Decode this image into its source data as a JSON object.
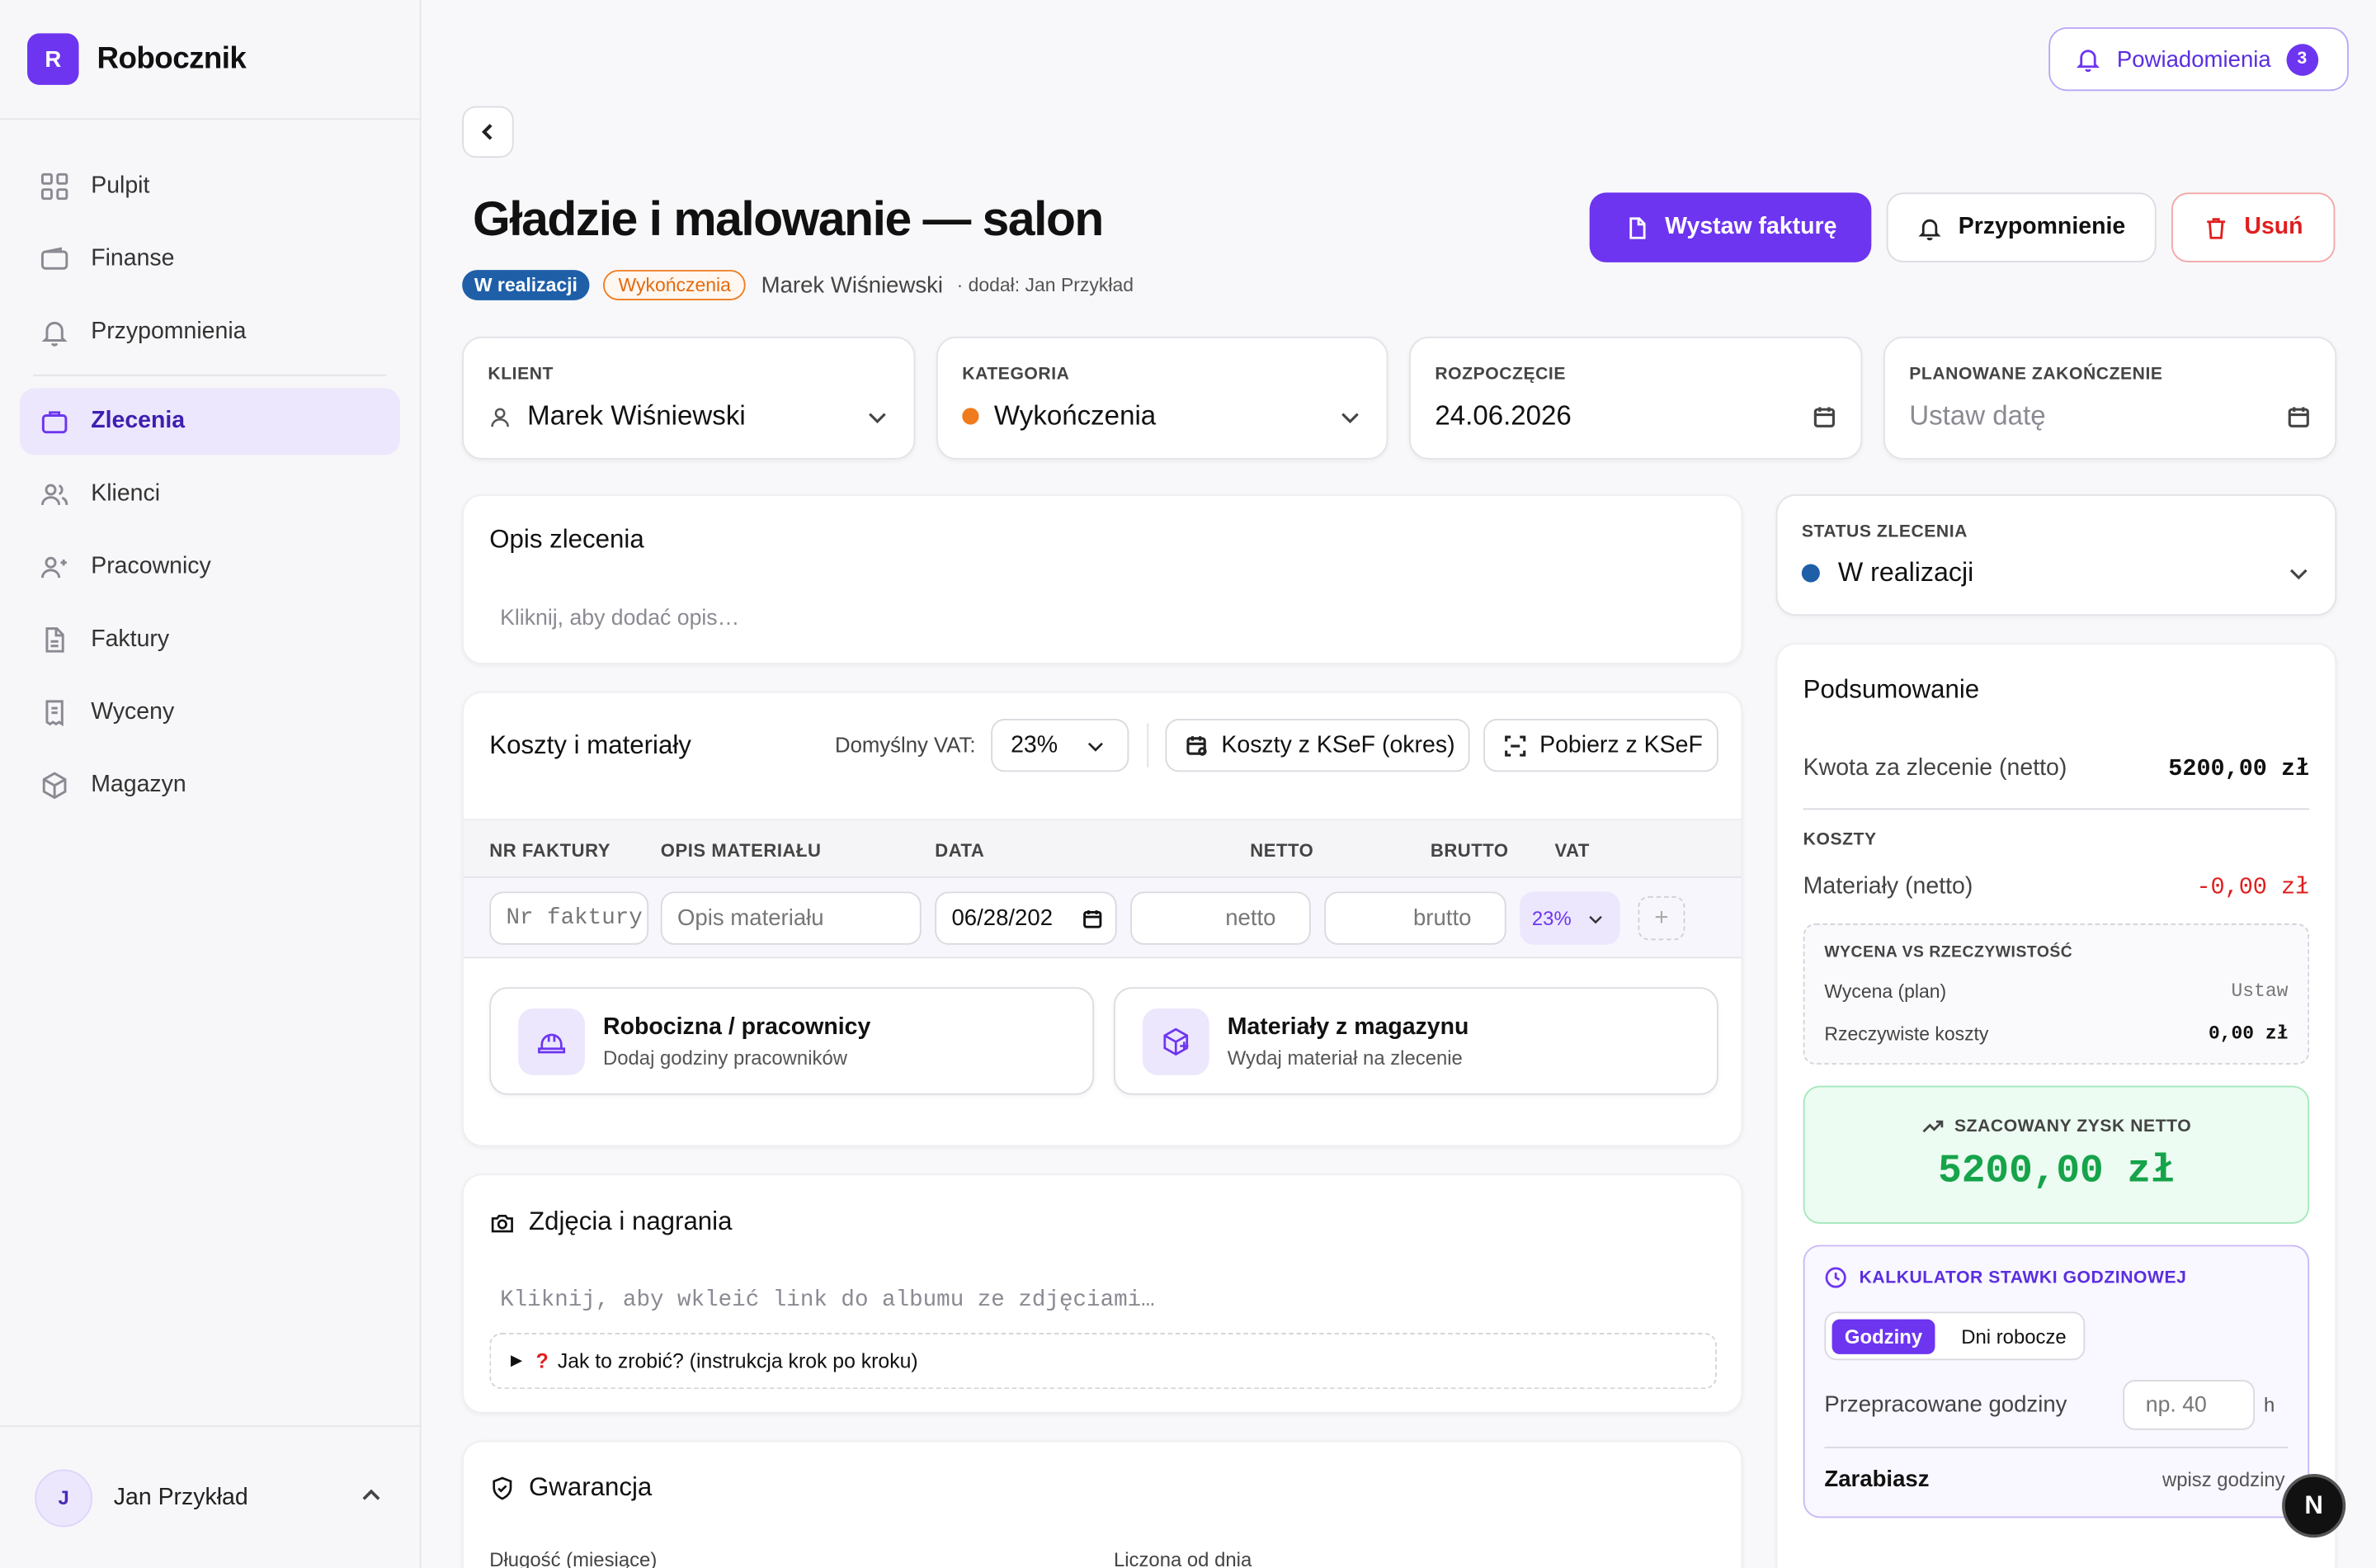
{
  "brand": {
    "initial": "R",
    "name": "Robocznik"
  },
  "sidebar": {
    "items": [
      {
        "label": "Pulpit",
        "icon": "grid-icon"
      },
      {
        "label": "Finanse",
        "icon": "wallet-icon"
      },
      {
        "label": "Przypomnienia",
        "icon": "bell-icon"
      },
      {
        "label": "Zlecenia",
        "icon": "briefcase-icon",
        "active": true
      },
      {
        "label": "Klienci",
        "icon": "users-icon"
      },
      {
        "label": "Pracownicy",
        "icon": "user-plus-icon"
      },
      {
        "label": "Faktury",
        "icon": "file-icon"
      },
      {
        "label": "Wyceny",
        "icon": "receipt-icon"
      },
      {
        "label": "Magazyn",
        "icon": "box-icon"
      }
    ],
    "user": {
      "initial": "J",
      "name": "Jan Przykład"
    }
  },
  "header": {
    "notifications_label": "Powiadomienia",
    "notifications_count": "3"
  },
  "order": {
    "title": "Gładzie i malowanie — salon",
    "status_badge": "W realizacji",
    "category_badge": "Wykończenia",
    "client": "Marek Wiśniewski",
    "added_by": "· dodał: Jan Przykład"
  },
  "actions": {
    "invoice": "Wystaw fakturę",
    "reminder": "Przypomnienie",
    "delete": "Usuń"
  },
  "fields": {
    "client_label": "KLIENT",
    "client_value": "Marek Wiśniewski",
    "category_label": "KATEGORIA",
    "category_value": "Wykończenia",
    "category_color": "#f07b1d",
    "start_label": "ROZPOCZĘCIE",
    "start_value": "24.06.2026",
    "end_label": "PLANOWANE ZAKOŃCZENIE",
    "end_placeholder": "Ustaw datę"
  },
  "description": {
    "title": "Opis zlecenia",
    "placeholder": "Kliknij, aby dodać opis…"
  },
  "costs": {
    "title": "Koszty i materiały",
    "vat_label": "Domyślny VAT:",
    "vat_value": "23%",
    "ksef_period": "Koszty z KSeF (okres)",
    "ksef_fetch": "Pobierz z KSeF",
    "columns": [
      "NR FAKTURY",
      "OPIS MATERIAŁU",
      "DATA",
      "NETTO",
      "BRUTTO",
      "VAT"
    ],
    "row": {
      "invoice_placeholder": "Nr faktury",
      "desc_placeholder": "Opis materiału",
      "date_value": "06/28/202",
      "net_placeholder": "netto",
      "gross_placeholder": "brutto",
      "vat_value": "23%"
    },
    "labor": {
      "title": "Robocizna / pracownicy",
      "subtitle": "Dodaj godziny pracowników"
    },
    "warehouse": {
      "title": "Materiały z magazynu",
      "subtitle": "Wydaj materiał na zlecenie"
    }
  },
  "photos": {
    "title": "Zdjęcia i nagrania",
    "placeholder": "Kliknij, aby wkleić link do albumu ze zdjęciami…",
    "help": "Jak to zrobić? (instrukcja krok po kroku)"
  },
  "warranty": {
    "title": "Gwarancja",
    "length_label": "Długość (miesiące)",
    "from_label": "Liczona od dnia"
  },
  "status": {
    "label": "STATUS ZLECENIA",
    "value": "W realizacji",
    "color": "#1f5fa8"
  },
  "summary": {
    "title": "Podsumowanie",
    "amount_label": "Kwota za zlecenie (netto)",
    "amount_value": "5200,00 zł",
    "costs_label": "KOSZTY",
    "materials_label": "Materiały (netto)",
    "materials_value": "-0,00 zł",
    "estimate_title": "WYCENA VS RZECZYWISTOŚĆ",
    "estimate_plan_label": "Wycena (plan)",
    "estimate_plan_value": "Ustaw",
    "actual_label": "Rzeczywiste koszty",
    "actual_value": "0,00 zł",
    "profit_label": "SZACOWANY ZYSK NETTO",
    "profit_value": "5200,00 zł"
  },
  "calculator": {
    "title": "KALKULATOR STAWKI GODZINOWEJ",
    "tab_hours": "Godziny",
    "tab_days": "Dni robocze",
    "hours_label": "Przepracowane godziny",
    "hours_placeholder": "np. 40",
    "hours_unit": "h",
    "earn_label": "Zarabiasz",
    "earn_value": "wpisz godziny"
  },
  "floating": {
    "badge": "N"
  }
}
